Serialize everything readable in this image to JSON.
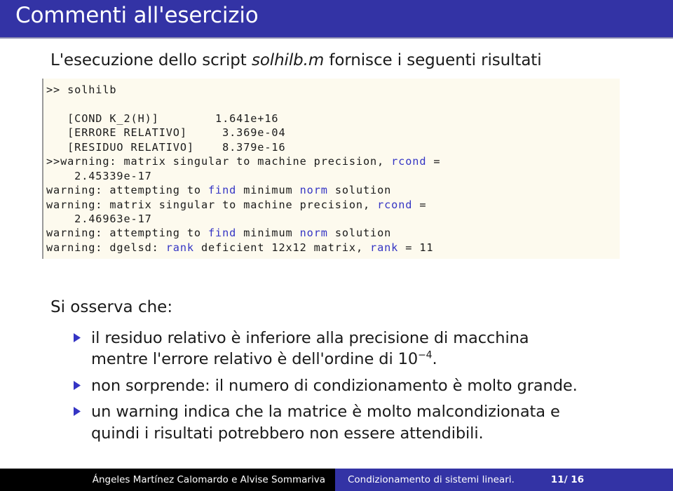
{
  "slide": {
    "title": "Commenti all'esercizio",
    "lead_sentence_before": "L'esecuzione dello script ",
    "lead_sentence_italic": "solhilb.m",
    "lead_sentence_after": " fornisce i seguenti risultati",
    "observation_heading": "Si osserva che:"
  },
  "colors": {
    "title_bar": "#3333a5",
    "footer_author_bg": "#000000",
    "footer_right_bg": "#3333a5",
    "code_bg": "#fdfaee",
    "keyword": "#3434c4",
    "bullet_marker": "#3434c4"
  },
  "code": {
    "prompt_line": ">> solhilb",
    "lines": [
      {
        "text": ">> solhilb"
      },
      {
        "text": ""
      },
      {
        "text": "   [COND K_2(H)]        1.641e+16"
      },
      {
        "text": "   [ERRORE RELATIVO]     3.369e-04"
      },
      {
        "text": "   [RESIDUO RELATIVO]    8.379e-16"
      },
      {
        "text": ">>warning: matrix singular to machine precision, rcond ="
      },
      {
        "text": "    2.45339e-17"
      },
      {
        "text": "warning: attempting to find minimum norm solution"
      },
      {
        "text": "warning: matrix singular to machine precision, rcond ="
      },
      {
        "text": "    2.46963e-17"
      },
      {
        "text": "warning: attempting to find minimum norm solution"
      },
      {
        "text": "warning: dgelsd: rank deficient 12x12 matrix, rank = 11"
      }
    ],
    "keywords": [
      "rcond",
      "find",
      "norm",
      "rank"
    ],
    "values": {
      "cond_k2_h": "1.641e+16",
      "errore_relativo": "3.369e-04",
      "residuo_relativo": "8.379e-16",
      "rcond_1": "2.45339e-17",
      "rcond_2": "2.46963e-17",
      "matrix_size": "12x12",
      "rank": "11"
    }
  },
  "bullets": [
    {
      "marker": "triangle-right-icon",
      "line1": "il residuo relativo è inferiore alla precisione di macchina",
      "line2_before": "mentre l'errore relativo è dell'ordine di 10",
      "line2_sup": "−4",
      "line2_after": "."
    },
    {
      "marker": "triangle-right-icon",
      "line1": "non sorprende: il numero di condizionamento è molto grande.",
      "line2_before": "",
      "line2_sup": "",
      "line2_after": ""
    },
    {
      "marker": "triangle-right-icon",
      "line1": "un warning indica che la matrice è molto malcondizionata e",
      "line2_before": "quindi i risultati potrebbero non essere attendibili.",
      "line2_sup": "",
      "line2_after": ""
    }
  ],
  "footer": {
    "authors": "Ángeles Martínez Calomardo e Alvise Sommariva",
    "subject": "Condizionamento di sistemi lineari.",
    "page": "11/ 16"
  }
}
